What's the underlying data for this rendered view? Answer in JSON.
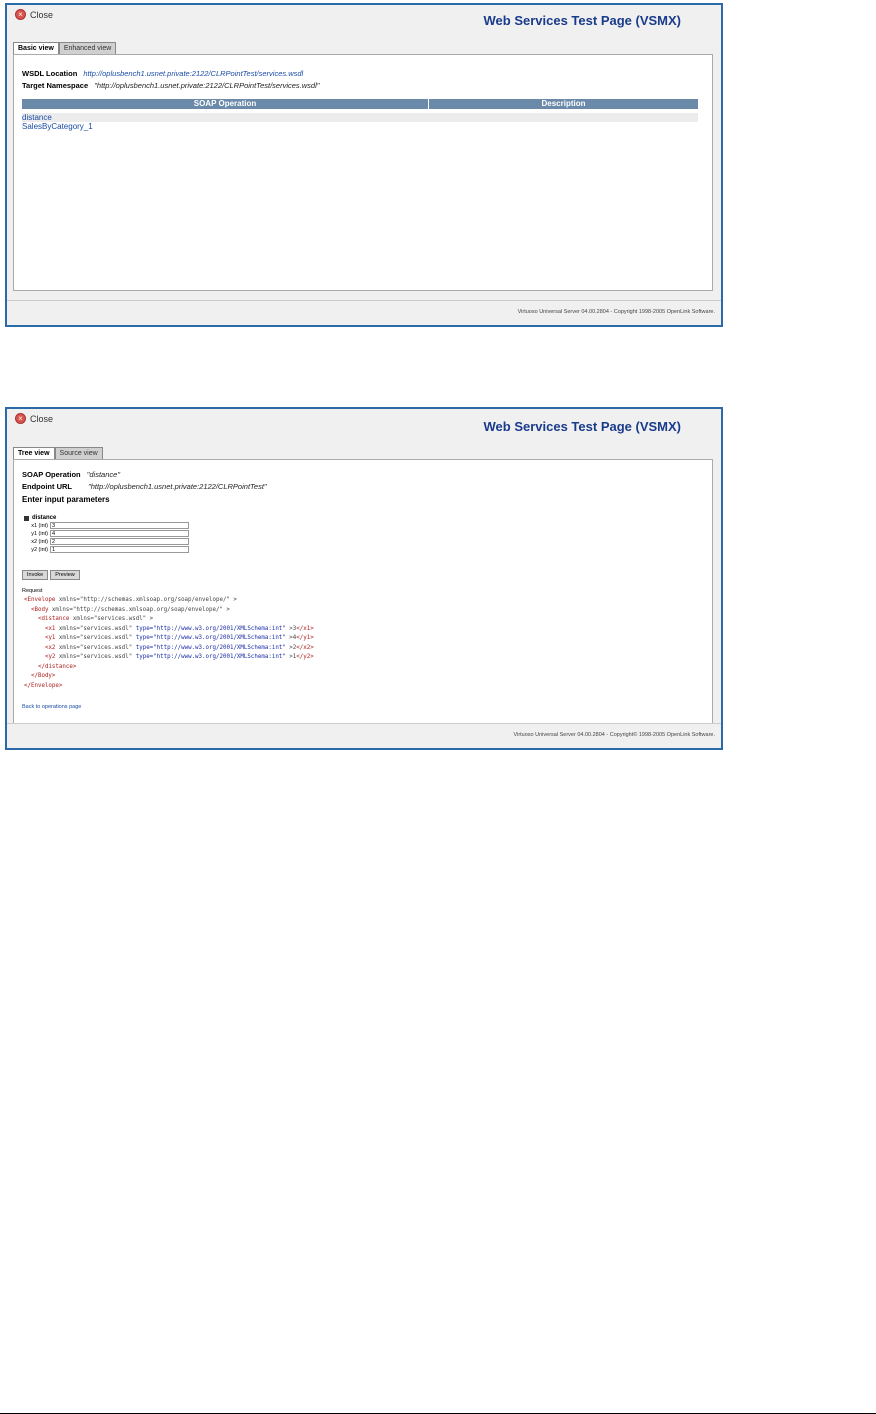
{
  "screen1": {
    "close_label": "Close",
    "title": "Web Services Test Page (VSMX)",
    "tabs": [
      {
        "label": "Basic view"
      },
      {
        "label": "Enhanced view"
      }
    ],
    "wsdl_location_label": "WSDL Location",
    "wsdl_location_value": "http://oplusbench1.usnet.private:2122/CLRPointTest/services.wsdl",
    "target_namespace_label": "Target Namespace",
    "target_namespace_value": "\"http://oplusbench1.usnet.private:2122/CLRPointTest/services.wsdl\"",
    "table_headers": [
      "SOAP Operation",
      "Description"
    ],
    "operations": [
      {
        "name": "distance"
      },
      {
        "name": "SalesByCategory_1"
      }
    ],
    "footer": "Virtuoso Universal Server 04.00.2804 - Copyright 1998-2005 OpenLink Software."
  },
  "screen2": {
    "close_label": "Close",
    "title": "Web Services Test Page (VSMX)",
    "tabs": [
      {
        "label": "Tree view"
      },
      {
        "label": "Source view"
      }
    ],
    "soap_operation_label": "SOAP Operation",
    "soap_operation_value": "\"distance\"",
    "endpoint_label": "Endpoint URL",
    "endpoint_value": "\"http://oplusbench1.usnet.private:2122/CLRPointTest\"",
    "enter_params_heading": "Enter input parameters",
    "group_name": "distance",
    "params": [
      {
        "label": "x1 (int)",
        "value": "3"
      },
      {
        "label": "y1 (int)",
        "value": "4"
      },
      {
        "label": "x2 (int)",
        "value": "2"
      },
      {
        "label": "y2 (int)",
        "value": "1"
      }
    ],
    "invoke_label": "Invoke",
    "preview_label": "Preview",
    "request_label": "Request",
    "xml": {
      "l1_tag": "<Envelope",
      "l1_attr": " xmlns=\"http://schemas.xmlsoap.org/soap/envelope/\" >",
      "l2_tag": "<Body",
      "l2_attr": " xmlns=\"http://schemas.xmlsoap.org/soap/envelope/\" >",
      "l3_tag": "<distance",
      "l3_attr": " xmlns=\"services.wsdl\" >",
      "rows": [
        {
          "open": "<x1",
          "ns": " xmlns=\"services.wsdl\" ",
          "type": "type=\"http://www.w3.org/2001/XMLSchema:int\"",
          "val": " >3",
          "close": "</x1>"
        },
        {
          "open": "<y1",
          "ns": " xmlns=\"services.wsdl\" ",
          "type": "type=\"http://www.w3.org/2001/XMLSchema:int\"",
          "val": " >4",
          "close": "</y1>"
        },
        {
          "open": "<x2",
          "ns": " xmlns=\"services.wsdl\" ",
          "type": "type=\"http://www.w3.org/2001/XMLSchema:int\"",
          "val": " >2",
          "close": "</x2>"
        },
        {
          "open": "<y2",
          "ns": " xmlns=\"services.wsdl\" ",
          "type": "type=\"http://www.w3.org/2001/XMLSchema:int\"",
          "val": " >1",
          "close": "</y2>"
        }
      ],
      "close_distance": "</distance>",
      "close_body": "</Body>",
      "close_envelope": "</Envelope>"
    },
    "back_link": "Back to operations page",
    "footer": "Virtuoso Universal Server 04.00.2804 - Copyright© 1998-2005 OpenLink Software."
  }
}
